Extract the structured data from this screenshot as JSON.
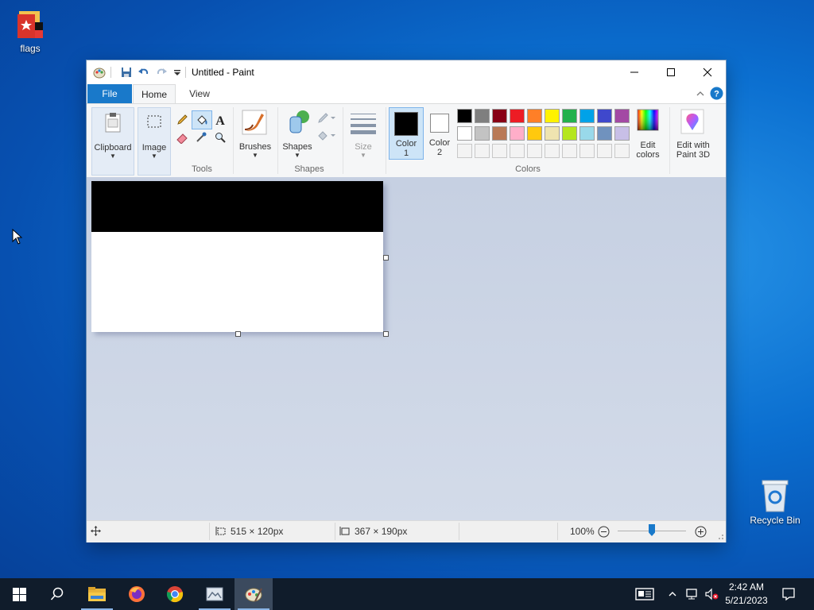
{
  "desktop": {
    "icons": [
      {
        "label": "flags"
      },
      {
        "label": "Recycle Bin"
      }
    ]
  },
  "window": {
    "title": "Untitled - Paint",
    "tabs": [
      {
        "label": "File"
      },
      {
        "label": "Home"
      },
      {
        "label": "View"
      }
    ],
    "ribbon": {
      "clipboard_label": "Clipboard",
      "image_label": "Image",
      "tools_group": "Tools",
      "brushes_label": "Brushes",
      "shapes_label": "Shapes",
      "shapes_group": "Shapes",
      "size_label": "Size",
      "color1_label": "Color",
      "color1_num": "1",
      "color2_label": "Color",
      "color2_num": "2",
      "colors_group": "Colors",
      "edit_colors_l1": "Edit",
      "edit_colors_l2": "colors",
      "paint3d_l1": "Edit with",
      "paint3d_l2": "Paint 3D",
      "color1_value": "#000000",
      "color2_value": "#ffffff",
      "palette_row1": [
        "#000000",
        "#7f7f7f",
        "#880015",
        "#ed1c24",
        "#ff7f27",
        "#fff200",
        "#22b14c",
        "#00a2e8",
        "#3f48cc",
        "#a349a4"
      ],
      "palette_row2": [
        "#ffffff",
        "#c3c3c3",
        "#b97a57",
        "#ffaec9",
        "#ffc90e",
        "#efe4b0",
        "#b5e61d",
        "#99d9ea",
        "#7092be",
        "#c8bfe7"
      ]
    },
    "canvas": {
      "band_color": "#000000",
      "background": "#ffffff"
    },
    "status": {
      "selection_size": "515 × 120px",
      "image_size": "367 × 190px",
      "zoom": "100%"
    }
  },
  "taskbar": {
    "time": "2:42 AM",
    "date": "5/21/2023"
  }
}
